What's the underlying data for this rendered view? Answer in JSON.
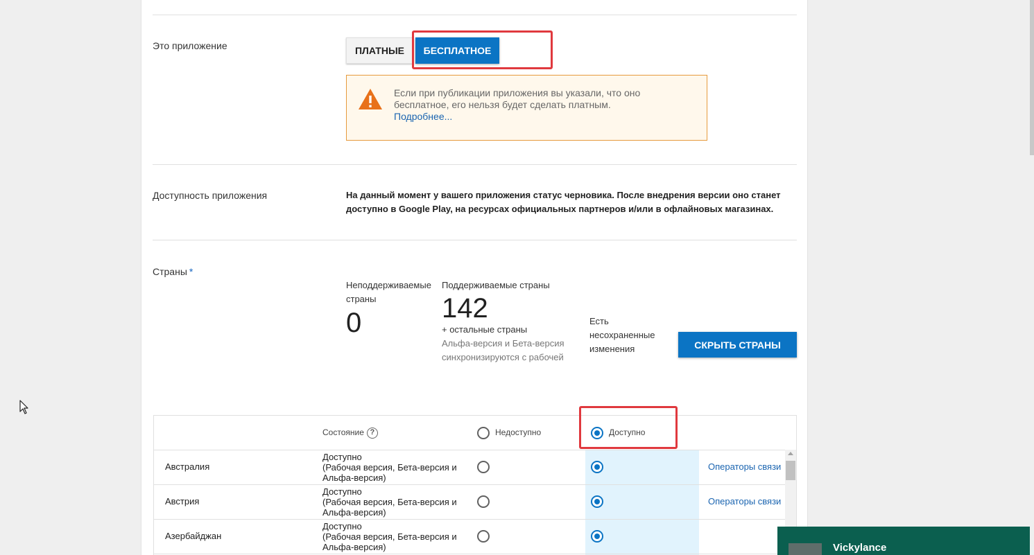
{
  "pricing": {
    "label": "Это приложение",
    "paid_label": "ПЛАТНЫЕ",
    "free_label": "БЕСПЛАТНОЕ",
    "selected": "free",
    "warning_text": "Если при публикации приложения вы указали, что оно бесплатное, его нельзя будет сделать платным.",
    "warning_link": "Подробнее..."
  },
  "availability": {
    "label": "Доступность приложения",
    "text": "На данный момент у вашего приложения статус черновика. После внедрения версии оно станет доступно в Google Play, на ресурсах официальных партнеров и/или в офлайновых магазинах."
  },
  "countries": {
    "label": "Страны",
    "required_mark": "*",
    "unsupported_label": "Неподдерживаемые страны",
    "unsupported_count": "0",
    "supported_label": "Поддерживаемые страны",
    "supported_count": "142",
    "rest_label": "+ остальные страны",
    "sync_note": "Альфа-версия и Бета-версия синхронизируются с рабочей",
    "unsaved_note": "Есть несохраненные изменения",
    "hide_button": "СКРЫТЬ СТРАНЫ"
  },
  "table": {
    "status_header": "Состояние",
    "help_glyph": "?",
    "unavailable_header": "Недоступно",
    "available_header": "Доступно",
    "rows": [
      {
        "country": "Австралия",
        "status_line1": "Доступно",
        "status_line2": "(Рабочая версия, Бета-версия и",
        "status_line3": "Альфа-версия)",
        "link": "Операторы связи"
      },
      {
        "country": "Австрия",
        "status_line1": "Доступно",
        "status_line2": "(Рабочая версия, Бета-версия и",
        "status_line3": "Альфа-версия)",
        "link": "Операторы связи"
      },
      {
        "country": "Азербайджан",
        "status_line1": "Доступно",
        "status_line2": "(Рабочая версия, Бета-версия и",
        "status_line3": "Альфа-версия)",
        "link": ""
      }
    ]
  },
  "popup": {
    "name": "Vickylance"
  },
  "colors": {
    "accent": "#0b74c4",
    "highlight_red": "#e0393e",
    "warning_border": "#e69a3c",
    "warning_icon": "#e8711a",
    "available_column": "#e1f3fd"
  }
}
